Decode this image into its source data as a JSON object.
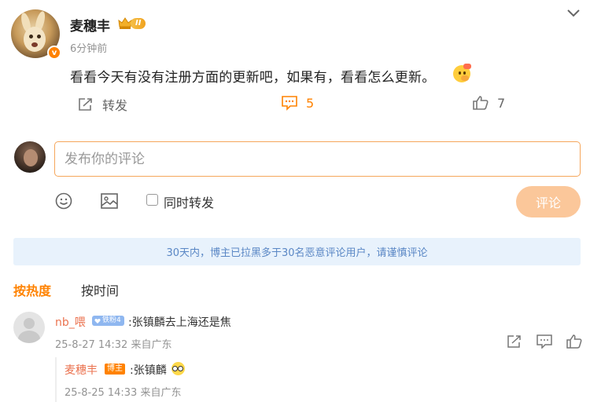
{
  "post": {
    "author": "麦穗丰",
    "level_badge": "II",
    "time": "6分钟前",
    "text": "看看今天有没有注册方面的更新吧，如果有，看看怎么更新。",
    "actions": {
      "repost_label": "转发",
      "comment_count": "5",
      "like_count": "7"
    }
  },
  "composer": {
    "placeholder": "发布你的评论",
    "repost_label": "同时转发",
    "submit_label": "评论"
  },
  "notice": "30天内，博主已拉黑多于30名恶意评论用户，请谨慎评论",
  "sort": {
    "hot": "按热度",
    "time": "按时间"
  },
  "comments": [
    {
      "user": "nb_喂",
      "badge": "铁粉4",
      "text": ":张镇麟去上海还是焦",
      "meta": "25-8-27 14:32 来自广东",
      "reply": {
        "user": "麦穗丰",
        "badge": "博主",
        "text": ":张镇麟",
        "meta": "25-8-25 14:33 来自广东"
      }
    }
  ],
  "colors": {
    "accent": "#ff8200",
    "link": "#eb7350",
    "notice_bg": "#e8f2fc",
    "notice_text": "#5a87c5"
  }
}
